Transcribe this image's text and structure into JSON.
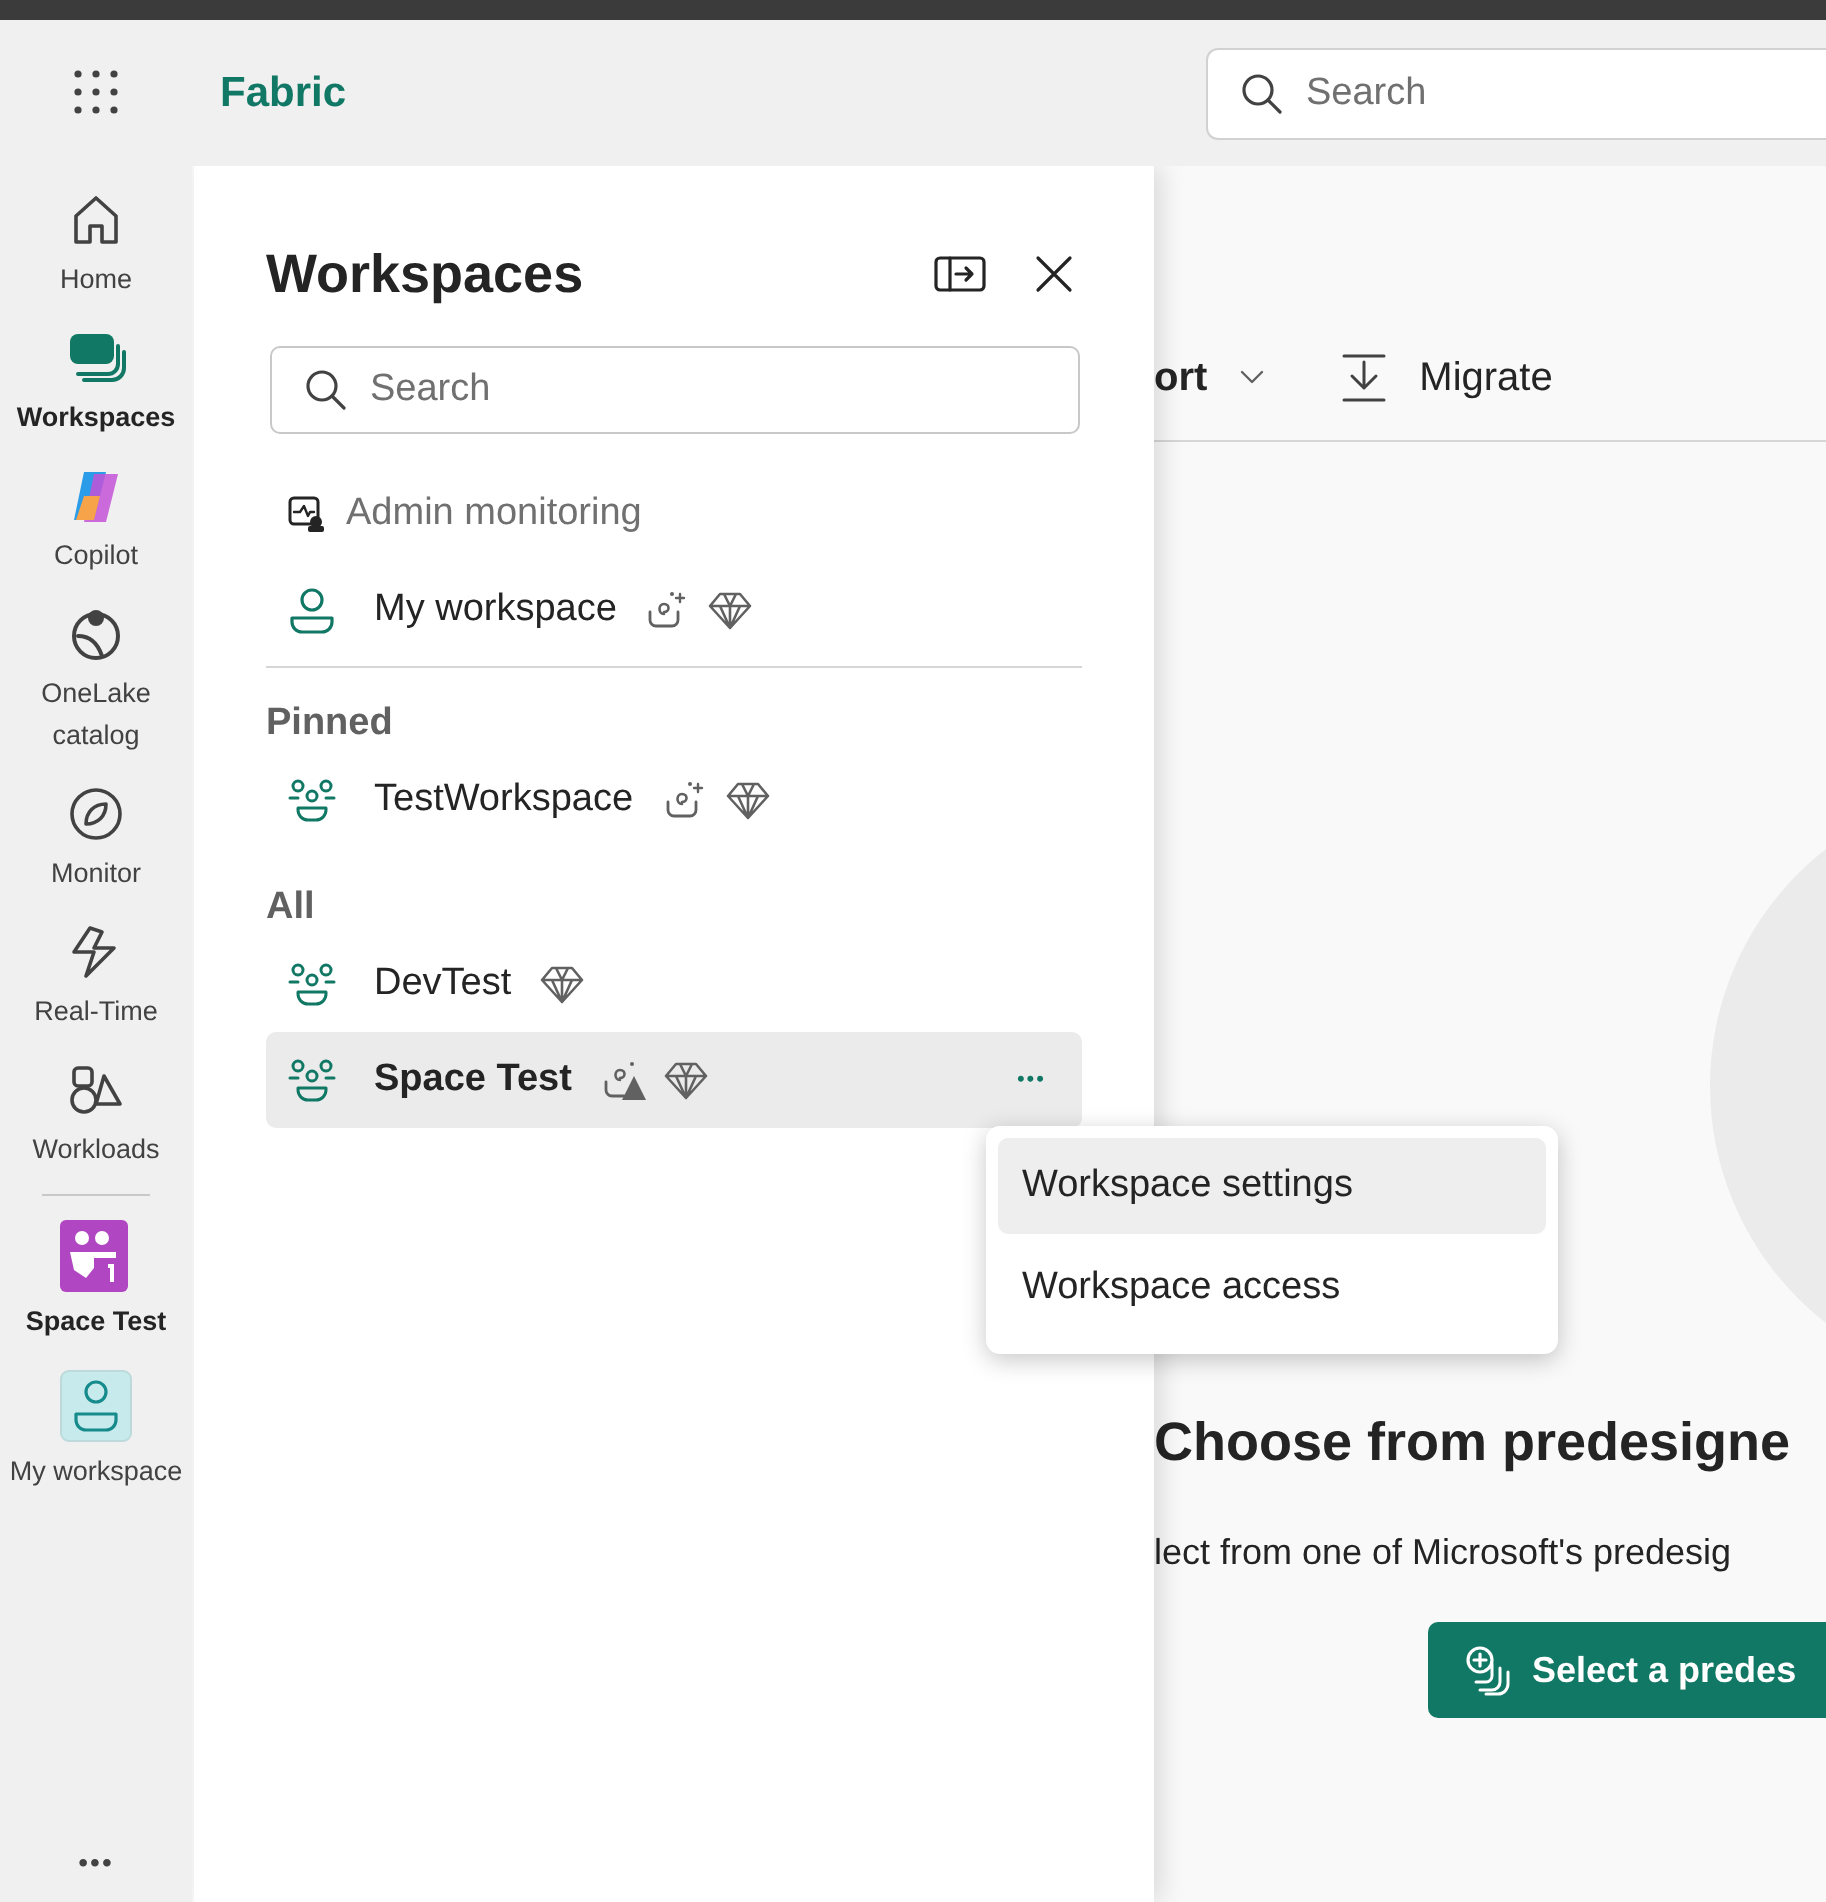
{
  "header": {
    "brand": "Fabric",
    "search": {
      "placeholder": "Search"
    }
  },
  "rail": {
    "items": [
      {
        "kind": "home",
        "label": "Home",
        "selected": false
      },
      {
        "kind": "workspaces",
        "label": "Workspaces",
        "selected": true
      },
      {
        "kind": "copilot",
        "label": "Copilot",
        "selected": false
      },
      {
        "kind": "onelake",
        "label": "OneLake catalog",
        "selected": false
      },
      {
        "kind": "monitor",
        "label": "Monitor",
        "selected": false
      },
      {
        "kind": "realtime",
        "label": "Real-Time",
        "selected": false
      },
      {
        "kind": "workloads",
        "label": "Workloads",
        "selected": false
      },
      {
        "kind": "divider"
      },
      {
        "kind": "space",
        "label": "Space Test",
        "selected": true
      },
      {
        "kind": "myworkspace",
        "label": "My workspace",
        "selected": false
      }
    ],
    "more": "•••"
  },
  "panel": {
    "title": "Workspaces",
    "search": {
      "placeholder": "Search"
    },
    "top_items": [
      {
        "kind": "admin",
        "label": "Admin monitoring"
      },
      {
        "kind": "person",
        "label": "My workspace",
        "copilot": true,
        "premium": true
      }
    ],
    "sections": [
      {
        "title": "Pinned",
        "items": [
          {
            "kind": "group",
            "label": "TestWorkspace",
            "copilot": true,
            "premium": true,
            "selected": false
          }
        ]
      },
      {
        "title": "All",
        "items": [
          {
            "kind": "group",
            "label": "DevTest",
            "copilot": false,
            "premium": true,
            "selected": false
          },
          {
            "kind": "group",
            "label": "Space Test",
            "copilot": true,
            "copilot_warning": true,
            "premium": true,
            "selected": true,
            "more": "•••"
          }
        ]
      }
    ]
  },
  "context_menu": {
    "items": [
      {
        "label": "Workspace settings",
        "selected": true
      },
      {
        "label": "Workspace access",
        "selected": false
      }
    ]
  },
  "main": {
    "toolbar": [
      {
        "kind": "dropdown",
        "label": "ort"
      },
      {
        "kind": "migrate",
        "label": "Migrate"
      }
    ],
    "heading": "Choose from predesigne",
    "subtitle": "lect from one of Microsoft's predesig",
    "button": "Select a predes"
  }
}
